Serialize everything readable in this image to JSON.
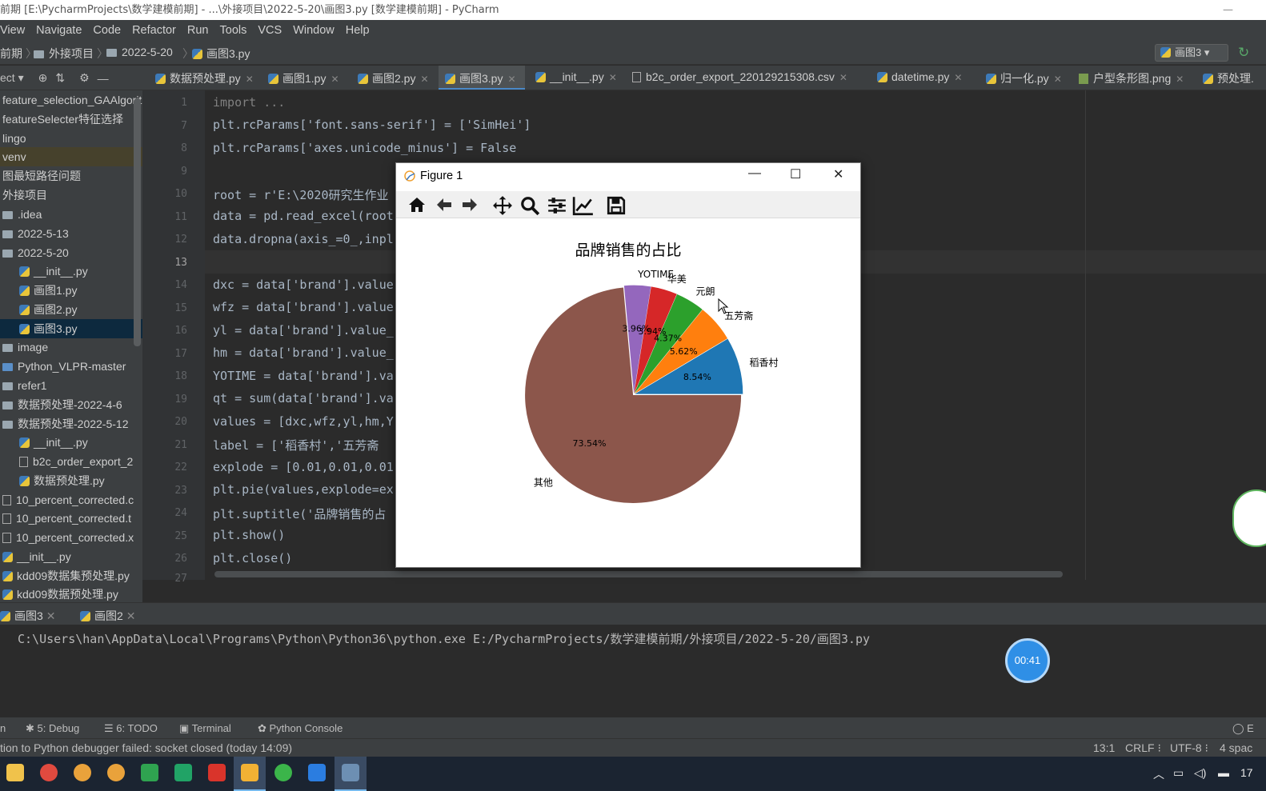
{
  "window": {
    "title": "前期 [E:\\PycharmProjects\\数学建模前期] - ...\\外接项目\\2022-5-20\\画图3.py [数学建模前期] - PyCharm"
  },
  "menu": [
    "View",
    "Navigate",
    "Code",
    "Refactor",
    "Run",
    "Tools",
    "VCS",
    "Window",
    "Help"
  ],
  "navbar": {
    "crumbs": [
      "前期",
      "外接项目",
      "2022-5-20",
      "画图3.py"
    ],
    "run_config": "画图3"
  },
  "project_panel": {
    "label": "ect",
    "items": [
      "feature_selection_GAAlgorithm",
      "featureSelecter特征选择",
      "lingo",
      "venv",
      "图最短路径问题",
      "外接项目",
      ".idea",
      "2022-5-13",
      "2022-5-20",
      "__init__.py",
      "画图1.py",
      "画图2.py",
      "画图3.py",
      "image",
      "Python_VLPR-master",
      "refer1",
      "数据预处理-2022-4-6",
      "数据预处理-2022-5-12",
      "__init__.py",
      "b2c_order_export_2",
      "数据预处理.py",
      "10_percent_corrected.c",
      "10_percent_corrected.t",
      "10_percent_corrected.x",
      "__init__.py",
      "kdd09数据集预处理.py",
      "kdd09数据预处理.py"
    ]
  },
  "tabs": [
    {
      "label": "数据预处理.py"
    },
    {
      "label": "画图1.py"
    },
    {
      "label": "画图2.py"
    },
    {
      "label": "画图3.py"
    },
    {
      "label": "__init__.py"
    },
    {
      "label": "b2c_order_export_220129215308.csv"
    },
    {
      "label": "datetime.py"
    },
    {
      "label": "归一化.py"
    },
    {
      "label": "户型条形图.png"
    },
    {
      "label": "预处理."
    }
  ],
  "editor": {
    "line_numbers": [
      "1",
      "7",
      "8",
      "9",
      "10",
      "11",
      "12",
      "13",
      "14",
      "15",
      "16",
      "17",
      "18",
      "19",
      "20",
      "21",
      "22",
      "23",
      "24",
      "25",
      "26",
      "27"
    ],
    "code": [
      {
        "t": "import ..."
      },
      {
        "t": "plt.rcParams['font.sans-serif'] = ['SimHei']"
      },
      {
        "t": "plt.rcParams['axes.unicode_minus'] = False"
      },
      {
        "t": ""
      },
      {
        "t": "root = r'E:\\2020研究生作业"
      },
      {
        "t": "data = pd.read_excel(root"
      },
      {
        "t": "data.dropna(axis_=0_,inpl"
      },
      {
        "t": ""
      },
      {
        "t": "dxc = data['brand'].value"
      },
      {
        "t": "wfz = data['brand'].value"
      },
      {
        "t": "yl = data['brand'].value_"
      },
      {
        "t": "hm = data['brand'].value_"
      },
      {
        "t": "YOTIME = data['brand'].va"
      },
      {
        "t": "qt = sum(data['brand'].va"
      },
      {
        "t": "values = [dxc,wfz,yl,hm,Y"
      },
      {
        "t": "label = ['稻香村','五芳斋"
      },
      {
        "t": "explode = [0.01,0.01,0.01"
      },
      {
        "t": "plt.pie(values,explode=ex"
      },
      {
        "t": "plt.suptitle('品牌销售的占"
      },
      {
        "t": "plt.show()"
      },
      {
        "t": "plt.close()"
      }
    ]
  },
  "figure": {
    "title": "Figure 1",
    "toolbar": [
      "home-icon",
      "back-icon",
      "forward-icon",
      "pan-icon",
      "zoom-icon",
      "configure-icon",
      "edit-axis-icon",
      "save-icon"
    ]
  },
  "chart_data": {
    "type": "pie",
    "title": "品牌销售的占比",
    "labels": [
      "稻香村",
      "五芳斋",
      "元朗",
      "华美",
      "YOTIME",
      "其他"
    ],
    "values": [
      8.54,
      5.62,
      4.37,
      3.94,
      3.96,
      73.54
    ],
    "pct_labels": [
      "8.54%",
      "5.62%",
      "4.37%",
      "3.94%",
      "3.96%",
      "73.54%"
    ],
    "colors": [
      "#1f77b4",
      "#ff7f0e",
      "#2ca02c",
      "#d62728",
      "#9467bd",
      "#8c564b"
    ],
    "explode": [
      0.01,
      0.01,
      0.01,
      0.01,
      0.01,
      0.01
    ],
    "start_angle": 0,
    "direction": "counterclockwise"
  },
  "run_panel": {
    "tabs": [
      "画图3",
      "画图2"
    ],
    "command": "C:\\Users\\han\\AppData\\Local\\Programs\\Python\\Python36\\python.exe E:/PycharmProjects/数学建模前期/外接项目/2022-5-20/画图3.py"
  },
  "timer": "00:41",
  "tool_windows": [
    "5: Debug",
    "6: TODO",
    "Terminal",
    "Python Console"
  ],
  "status": {
    "message": "tion to Python debugger failed: socket closed (today 14:09)",
    "position": "13:1",
    "line_sep": "CRLF ⁝",
    "encoding": "UTF-8 ⁝",
    "indent": "4 spac"
  },
  "taskbar": {
    "clock": "17"
  }
}
